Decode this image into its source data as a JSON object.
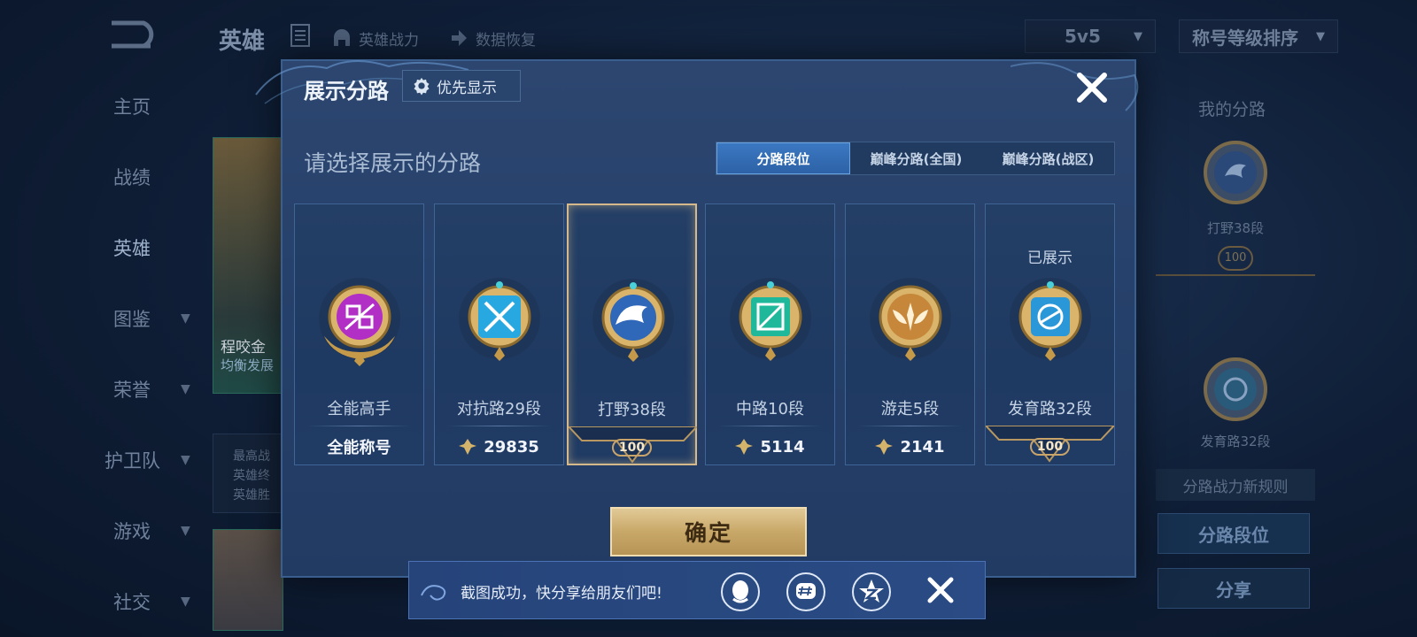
{
  "topbar": {
    "title": "英雄",
    "links": [
      "英雄战力",
      "数据恢复"
    ],
    "mode_select": "5v5",
    "sort_select": "称号等级排序"
  },
  "leftnav": {
    "items": [
      {
        "label": "主页",
        "chevron": false,
        "active": false
      },
      {
        "label": "战绩",
        "chevron": false,
        "active": false
      },
      {
        "label": "英雄",
        "chevron": false,
        "active": true
      },
      {
        "label": "图鉴",
        "chevron": true,
        "active": false
      },
      {
        "label": "荣誉",
        "chevron": true,
        "active": false
      },
      {
        "label": "护卫队",
        "chevron": true,
        "active": false
      },
      {
        "label": "游戏",
        "chevron": true,
        "active": false
      },
      {
        "label": "社交",
        "chevron": true,
        "active": false
      }
    ]
  },
  "background_hero": {
    "name": "程咬金",
    "subtitle": "均衡发展",
    "lines": [
      "最高战",
      "英雄终",
      "英雄胜"
    ]
  },
  "rightpanel": {
    "title": "我的分路",
    "lane1": "打野38段",
    "lane1_rank": "100",
    "lane2": "发育路32段",
    "rule": "分路战力新规则",
    "btn1": "分路段位",
    "btn2": "分享"
  },
  "modal": {
    "title": "展示分路",
    "priority_button": "优先显示",
    "prompt": "请选择展示的分路",
    "tabs": [
      {
        "label": "分路段位",
        "active": true
      },
      {
        "label": "巅峰分路(全国)",
        "active": false
      },
      {
        "label": "巅峰分路(战区)",
        "active": false
      }
    ],
    "cards": [
      {
        "name": "全能高手",
        "footer": "全能称号",
        "footer_type": "text",
        "shown": "",
        "selected": false,
        "color": "#b12fc4",
        "emblem": "allround"
      },
      {
        "name": "对抗路29段",
        "footer": "29835",
        "footer_type": "points",
        "shown": "",
        "selected": false,
        "color": "#28a8e0",
        "emblem": "sword"
      },
      {
        "name": "打野38段",
        "footer": "100",
        "footer_type": "rank",
        "shown": "",
        "selected": true,
        "color": "#2f68b8",
        "emblem": "dragon"
      },
      {
        "name": "中路10段",
        "footer": "5114",
        "footer_type": "points",
        "shown": "",
        "selected": false,
        "color": "#1fb89a",
        "emblem": "mid"
      },
      {
        "name": "游走5段",
        "footer": "2141",
        "footer_type": "points",
        "shown": "",
        "selected": false,
        "color": "#c6873b",
        "emblem": "wings"
      },
      {
        "name": "发育路32段",
        "footer": "100",
        "footer_type": "rank",
        "shown": "已展示",
        "selected": false,
        "color": "#2a98d8",
        "emblem": "adc"
      }
    ],
    "confirm": "确定"
  },
  "toast": {
    "message": "截图成功，快分享给朋友们吧!",
    "share_icons": [
      "qq-icon",
      "wechat-moments-icon",
      "qzone-icon"
    ]
  }
}
